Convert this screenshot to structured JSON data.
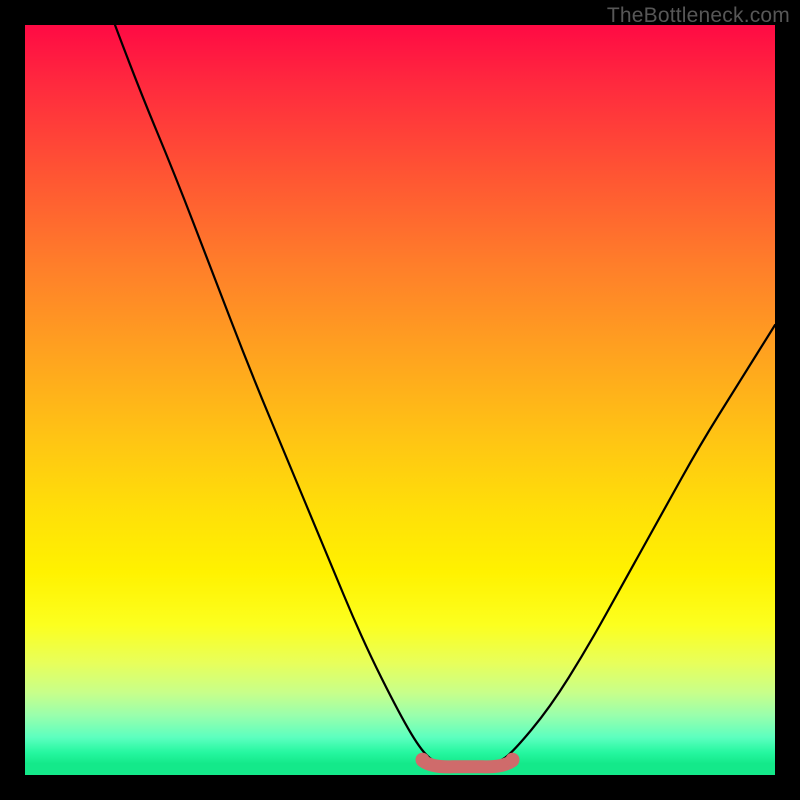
{
  "watermark": "TheBottleneck.com",
  "chart_data": {
    "type": "line",
    "title": "",
    "xlabel": "",
    "ylabel": "",
    "xlim": [
      0,
      100
    ],
    "ylim": [
      0,
      100
    ],
    "series": [
      {
        "name": "curve",
        "x": [
          12,
          15,
          20,
          25,
          30,
          35,
          40,
          45,
          50,
          53,
          55,
          57,
          60,
          63,
          65,
          70,
          75,
          80,
          85,
          90,
          95,
          100
        ],
        "values": [
          100,
          92,
          80,
          67,
          54,
          42,
          30,
          18,
          8,
          3,
          1.5,
          1.2,
          1.2,
          1.6,
          3,
          9,
          17,
          26,
          35,
          44,
          52,
          60
        ]
      }
    ],
    "flat_bottom_marker": {
      "x_range": [
        53,
        65
      ],
      "y": 1.5,
      "color": "#cf6b6b"
    },
    "gradient_stops": [
      {
        "pos": 0.0,
        "color": "#ff0a44"
      },
      {
        "pos": 0.5,
        "color": "#ffc414"
      },
      {
        "pos": 0.78,
        "color": "#fff200"
      },
      {
        "pos": 1.0,
        "color": "#14e98a"
      }
    ]
  }
}
